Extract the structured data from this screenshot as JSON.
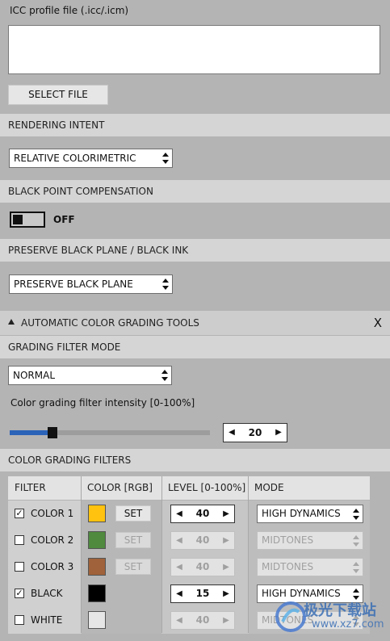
{
  "icc": {
    "label": "ICC profile file (.icc/.icm)",
    "value": "",
    "select_button": "SELECT FILE"
  },
  "rendering_intent": {
    "header": "RENDERING INTENT",
    "selected": "RELATIVE COLORIMETRIC"
  },
  "black_point": {
    "header": "BLACK POINT COMPENSATION",
    "state": "OFF"
  },
  "preserve_black": {
    "header": "PRESERVE BLACK PLANE / BLACK INK",
    "selected": "PRESERVE BLACK PLANE"
  },
  "grading": {
    "header": "AUTOMATIC COLOR GRADING TOOLS",
    "close_label": "X",
    "mode_header": "GRADING FILTER MODE",
    "mode_selected": "NORMAL",
    "intensity_label": "Color grading filter intensity [0-100%]",
    "intensity_value": "20",
    "intensity_fraction": 0.2,
    "filters_header": "COLOR GRADING FILTERS"
  },
  "table": {
    "headers": {
      "filter": "FILTER",
      "color": "COLOR [RGB]",
      "level": "LEVEL [0-100%]",
      "mode": "MODE"
    },
    "set_label": "SET",
    "rows": [
      {
        "label": "COLOR 1",
        "checked": true,
        "color": "#ffc20e",
        "level": "40",
        "mode": "HIGH DYNAMICS"
      },
      {
        "label": "COLOR 2",
        "checked": false,
        "color": "#4f8a3f",
        "level": "40",
        "mode": "MIDTONES"
      },
      {
        "label": "COLOR 3",
        "checked": false,
        "color": "#a0623a",
        "level": "40",
        "mode": "MIDTONES"
      },
      {
        "label": "BLACK",
        "checked": true,
        "color": "#000000",
        "level": "15",
        "mode": "HIGH DYNAMICS"
      },
      {
        "label": "WHITE",
        "checked": false,
        "color": "#e6e6e6",
        "level": "40",
        "mode": "MIDTONES"
      }
    ]
  },
  "watermark": {
    "text": "极光下载站",
    "url": "www.xz7.com"
  }
}
